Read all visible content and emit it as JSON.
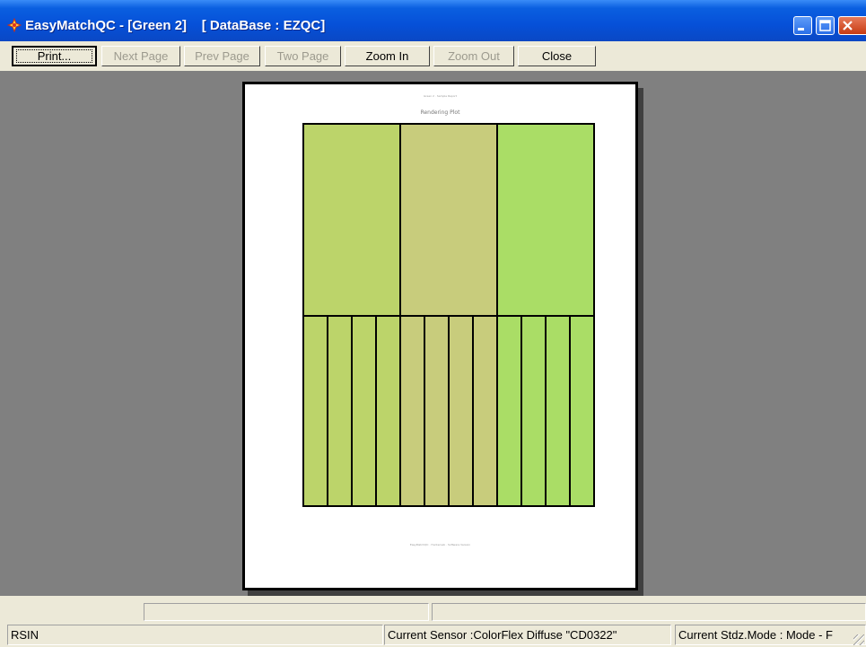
{
  "window": {
    "title": "EasyMatchQC - [Green 2]    [ DataBase : EZQC]",
    "controls": {
      "minimize_icon": "minimize-icon",
      "maximize_icon": "maximize-icon",
      "close_icon": "close-icon"
    }
  },
  "toolbar": {
    "print": "Print...",
    "next_page": "Next Page",
    "prev_page": "Prev Page",
    "two_page": "Two Page",
    "zoom_in": "Zoom In",
    "zoom_out": "Zoom Out",
    "close": "Close"
  },
  "preview": {
    "header_text": "Green 2 · Sample Report",
    "title": "Rendering Plot",
    "footer_text": "EasyMatchQC · HunterLab · Software Version",
    "large_swatch_colors": [
      "#bcd46a",
      "#c8cc7c",
      "#aadd66"
    ],
    "small_swatch_colors": [
      "#bcd46a",
      "#bcd46a",
      "#bcd46a",
      "#bcd46a",
      "#c8cc7c",
      "#c8cc7c",
      "#c8cc7c",
      "#c8cc7c",
      "#aadd66",
      "#aadd66",
      "#aadd66",
      "#aadd66"
    ]
  },
  "status": {
    "left": "RSIN",
    "sensor": "Current Sensor :ColorFlex Diffuse \"CD0322\"",
    "mode": "Current Stdz.Mode :  Mode - F"
  }
}
